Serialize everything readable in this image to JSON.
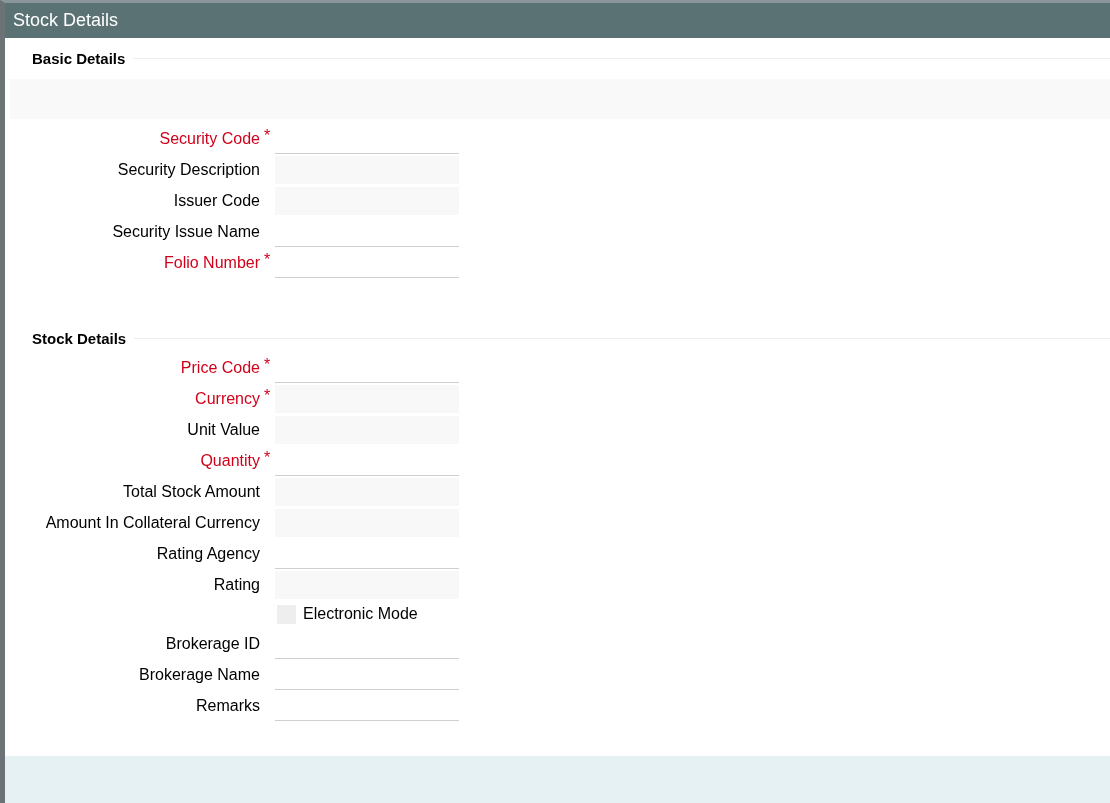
{
  "window": {
    "title": "Stock Details"
  },
  "sections": [
    {
      "title": "Basic Details",
      "band": true,
      "fields": [
        {
          "kind": "input",
          "label": "Security Code",
          "required": true,
          "marker": "*"
        },
        {
          "kind": "readonly",
          "label": "Security Description",
          "required": false
        },
        {
          "kind": "readonly",
          "label": "Issuer Code",
          "required": false
        },
        {
          "kind": "input",
          "label": "Security Issue Name",
          "required": false
        },
        {
          "kind": "input",
          "label": "Folio Number",
          "required": true,
          "marker": "*"
        }
      ]
    },
    {
      "title": "Stock Details",
      "band": false,
      "fields": [
        {
          "kind": "input",
          "label": "Price Code",
          "required": true,
          "marker": "*"
        },
        {
          "kind": "readonly",
          "label": "Currency",
          "required": true,
          "marker": "*"
        },
        {
          "kind": "readonly",
          "label": "Unit Value",
          "required": false
        },
        {
          "kind": "input",
          "label": "Quantity",
          "required": true,
          "marker": "*"
        },
        {
          "kind": "readonly",
          "label": "Total Stock Amount",
          "required": false
        },
        {
          "kind": "readonly",
          "label": "Amount In Collateral Currency",
          "required": false
        },
        {
          "kind": "input",
          "label": "Rating Agency",
          "required": false
        },
        {
          "kind": "readonly",
          "label": "Rating",
          "required": false
        },
        {
          "kind": "checkbox",
          "label": "Electronic Mode",
          "checked": false
        },
        {
          "kind": "input",
          "label": "Brokerage ID",
          "required": false
        },
        {
          "kind": "input",
          "label": "Brokerage Name",
          "required": false
        },
        {
          "kind": "input",
          "label": "Remarks",
          "required": false
        }
      ]
    }
  ]
}
